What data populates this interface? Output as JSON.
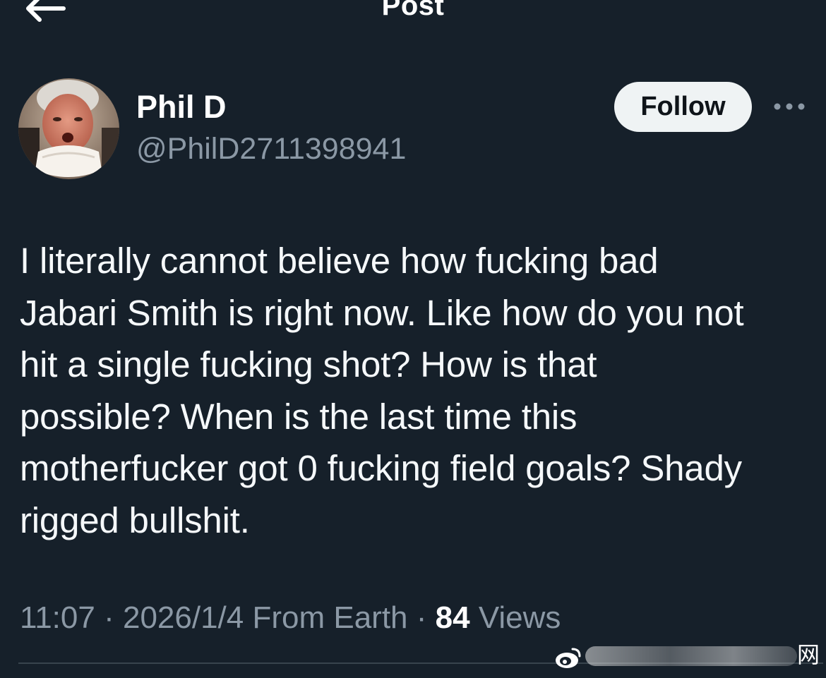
{
  "header": {
    "title": "Post",
    "back_icon": "arrow-left-icon"
  },
  "author": {
    "name": "Phil D",
    "handle": "@PhilD2711398941",
    "follow_label": "Follow",
    "more_icon": "more-horizontal-icon"
  },
  "post": {
    "text": "I literally cannot believe how fucking bad\nJabari Smith is right now. Like how do you not\nhit a single fucking shot? How is that\npossible? When is the last time this\nmotherfucker got 0 fucking field goals? Shady\nrigged bullshit."
  },
  "meta": {
    "time": "11:07",
    "sep1": "·",
    "date": "2026/1/4",
    "source": "From Earth",
    "sep2": "·",
    "views_count": "84",
    "views_label": "Views"
  },
  "watermark": {
    "char": "网"
  },
  "colors": {
    "background": "#16202a",
    "text": "#ffffff",
    "secondary_text": "#8b98a5",
    "follow_bg": "#eff3f4",
    "divider": "#38444d"
  }
}
